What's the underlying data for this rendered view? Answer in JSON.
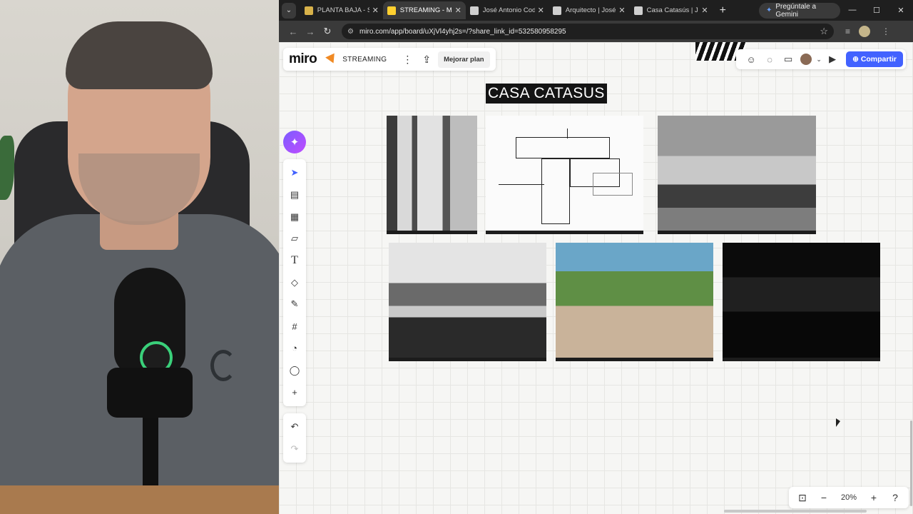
{
  "browser": {
    "tabs": [
      {
        "title": "PLANTA BAJA - St",
        "active": false,
        "favicon_color": "#d8b24a"
      },
      {
        "title": "STREAMING - Mi",
        "active": true,
        "favicon_color": "#ffd02f"
      },
      {
        "title": "José Antonio Cod",
        "active": false,
        "favicon_color": "#cfcfcf"
      },
      {
        "title": "Arquitecto | José",
        "active": false,
        "favicon_color": "#cfcfcf"
      },
      {
        "title": "Casa Catasús | Jo",
        "active": false,
        "favicon_color": "#cfcfcf"
      }
    ],
    "gemini_label": "Pregúntale a Gemini",
    "url": "miro.com/app/board/uXjVl4yhj2s=/?share_link_id=532580958295"
  },
  "miro": {
    "logo": "miro",
    "board_name": "STREAMING",
    "upgrade_label": "Mejorar plan",
    "share_label": "Compartir",
    "frame_title": "CASA CATASUS",
    "zoom": "20%",
    "brand_color": "#4262ff",
    "tools": [
      "select-icon",
      "templates-icon",
      "table-icon",
      "sticky-note-icon",
      "text-icon",
      "shapes-icon",
      "pen-icon",
      "frame-icon",
      "sticker-icon",
      "comment-icon",
      "add-icon"
    ]
  }
}
